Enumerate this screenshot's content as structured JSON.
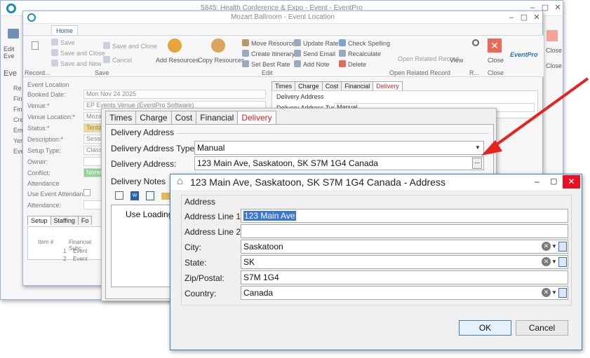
{
  "back_window": {
    "title": "5845: Health Conference & Expo - Event - EventPro",
    "sidebar_title": "Eve",
    "edit_label": "Edit Eve",
    "sidebar_items": [
      "Re",
      "Fin",
      "Fin",
      "Cre",
      "Em",
      "Yer",
      "Eve"
    ]
  },
  "mid_window": {
    "title": "Mozart Ballroom - Event Location",
    "ribbon_tab": "Home",
    "record_label": "Record...",
    "save_group": {
      "save": "Save",
      "save_close": "Save and Close",
      "save_new": "Save and New",
      "save_clone": "Save and Clone",
      "cancel": "Cancel",
      "label": "Save"
    },
    "edit_group": {
      "add_resources": "Add Resources",
      "copy_resources": "Copy Resources",
      "move_resources": "Move Resources",
      "create_itinerary": "Create Itinerary",
      "set_best_rate": "Set Best Rate",
      "update_rate": "Update Rate",
      "send_email": "Send Email",
      "add_note": "Add Note",
      "check_spelling": "Check Spelling",
      "recalculate": "Recalculate",
      "delete": "Delete",
      "label": "Edit"
    },
    "open_related": {
      "button": "Open Related Record",
      "label": "Open Related Record"
    },
    "view": {
      "button": "View",
      "label": "R..."
    },
    "close": {
      "button": "Close",
      "label": "Close"
    },
    "logo": "EventPro",
    "outer_close": "Close",
    "form": {
      "section": "Event Location",
      "booked_date_label": "Booked Date:",
      "booked_date_value": "Mon Nov 24 2025",
      "venue_label": "Venue:*",
      "venue_value": "EP Events Venue (EventPro Software)",
      "venue_location_label": "Venue Location:*",
      "venue_location_value": "Mozart",
      "status_label": "Status:*",
      "status_value": "Tentat",
      "description_label": "Description:*",
      "description_value": "Session",
      "setup_type_label": "Setup Type:",
      "setup_type_value": "Classro",
      "owner_label": "Owner:",
      "conflict_label": "Conflict:",
      "conflict_value": "None",
      "attendance_section": "Attendance",
      "use_attendance_label": "Use Event Attendance",
      "attendance_label": "Attendance:"
    },
    "bottom_tabs": [
      "Setup",
      "Staffing",
      "Fo"
    ],
    "grid": {
      "col1": "Item #",
      "col2": "Financial Subc",
      "rows": [
        {
          "num": "1",
          "type": "Event"
        },
        {
          "num": "2",
          "type": "Event"
        }
      ]
    },
    "right_tabs": [
      "Times",
      "Charge",
      "Cost",
      "Financial",
      "Delivery"
    ],
    "right_group": "Delivery Address",
    "right_type_label": "Delivery Address Type:",
    "right_type_value": "Manual"
  },
  "delivery_window": {
    "tabs": [
      "Times",
      "Charge",
      "Cost",
      "Financial",
      "Delivery"
    ],
    "active_tab": "Delivery",
    "group_title": "Delivery Address",
    "type_label": "Delivery Address Type:",
    "type_value": "Manual",
    "address_label": "Delivery Address:",
    "address_value": "123 Main Ave, Saskatoon, SK S7M 1G4 Canada",
    "ellipsis": "...",
    "notes_title": "Delivery Notes",
    "notes_text": "Use Loading"
  },
  "address_dialog": {
    "title": "123 Main Ave, Saskatoon, SK S7M 1G4 Canada - Address",
    "group": "Address",
    "line1_label": "Address Line 1:",
    "line1_value": "123 Main Ave",
    "line2_label": "Address Line 2:",
    "line2_value": "",
    "city_label": "City:",
    "city_value": "Saskatoon",
    "state_label": "State:",
    "state_value": "SK",
    "zip_label": "Zip/Postal:",
    "zip_value": "S7M 1G4",
    "country_label": "Country:",
    "country_value": "Canada",
    "ok": "OK",
    "cancel": "Cancel"
  },
  "colors": {
    "arrow": "#e8231c",
    "accent": "#3b76d6",
    "active_tab": "#d42020"
  }
}
